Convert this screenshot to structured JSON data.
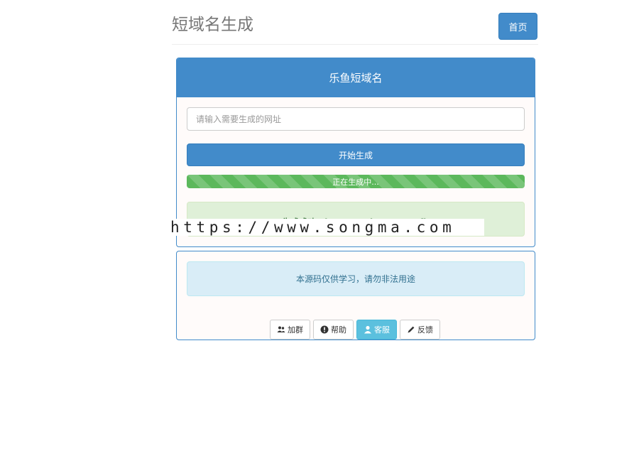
{
  "header": {
    "title": "短域名生成",
    "home_label": "首页"
  },
  "main_panel": {
    "heading": "乐鱼短域名",
    "input_placeholder": "请输入需要生成的网址",
    "input_value": "",
    "generate_label": "开始生成",
    "progress_text": "正在生成中...",
    "progress_percent": 100,
    "success_text": "生成成功：https://url.cn/5SLE2fb"
  },
  "watermark": "https://www.songma.com",
  "info_panel": {
    "notice": "本源码仅供学习，请勿非法用途",
    "buttons": [
      {
        "label": "加群",
        "icon": "users-icon"
      },
      {
        "label": "帮助",
        "icon": "help-icon"
      },
      {
        "label": "客服",
        "icon": "user-icon"
      },
      {
        "label": "反馈",
        "icon": "pencil-icon"
      }
    ]
  },
  "colors": {
    "primary": "#428bca",
    "success": "#5cb85c",
    "success_bg": "#dff0d8",
    "info": "#5bc0de",
    "info_bg": "#d9edf7"
  }
}
